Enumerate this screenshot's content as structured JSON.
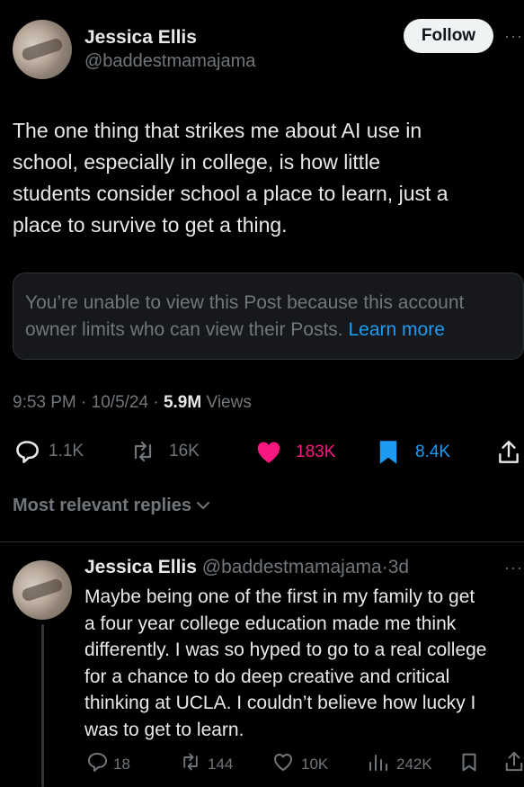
{
  "post": {
    "author_name": "Jessica Ellis",
    "author_handle": "@baddestmamajama",
    "follow_label": "Follow",
    "more_label": "···",
    "text_lines": [
      "The one thing that strikes me about AI use in",
      "school, especially in college, is how little",
      "students consider school a place to learn, just a",
      "place to survive to get a thing."
    ],
    "notice_text": "You’re unable to view this Post because this account owner limits who can view their Posts.",
    "notice_link": "Learn more",
    "time": "9:53 PM",
    "date": "10/5/24",
    "sep": "·",
    "views_count": "5.9M",
    "views_label": "Views",
    "stats": {
      "replies": "1.1K",
      "reposts": "16K",
      "likes": "183K",
      "bookmarks": "8.4K"
    },
    "colors": {
      "like": "#f91880",
      "bookmark": "#1d9bf0",
      "link": "#1d9bf0"
    }
  },
  "replies_filter": {
    "label": "Most relevant replies"
  },
  "reply": {
    "author_name": "Jessica Ellis",
    "author_handle": "@baddestmamajama",
    "age": "3d",
    "sep": "·",
    "more_label": "···",
    "text_lines": [
      "Maybe being one of the first in my family to get",
      "a four year college education made me think",
      "differently. I was so hyped to go to a real college",
      "for a  chance to do deep creative and critical",
      "thinking at UCLA. I couldn’t believe how lucky I",
      "was to get to learn."
    ],
    "stats": {
      "replies": "18",
      "reposts": "144",
      "likes": "10K",
      "views": "242K"
    }
  },
  "icons": [
    "reply-icon",
    "repost-icon",
    "heart-icon",
    "bookmark-icon",
    "share-icon",
    "views-icon",
    "chevron-down-icon",
    "more-icon"
  ]
}
